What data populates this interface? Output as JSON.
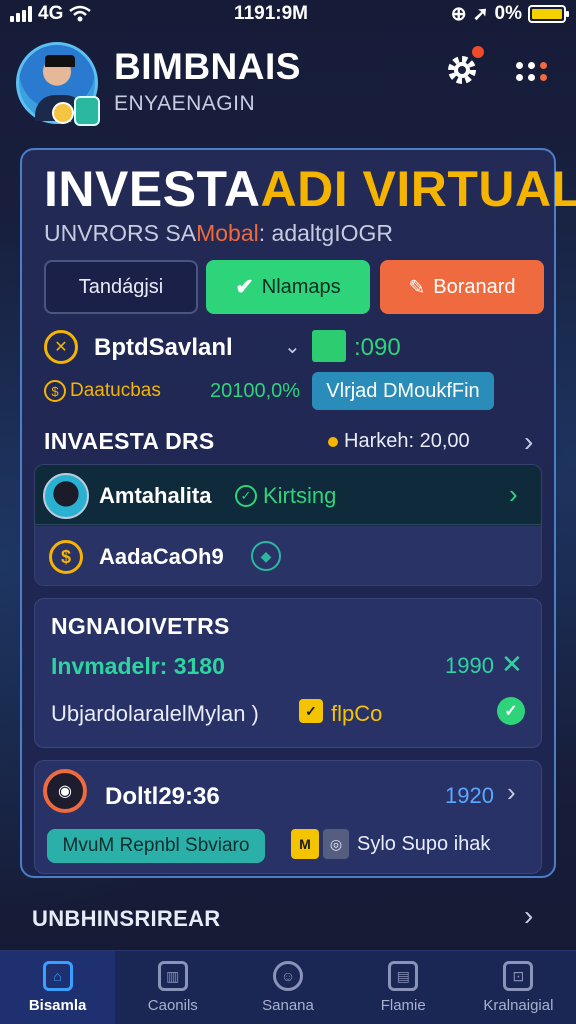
{
  "status_bar": {
    "carrier": "4G",
    "time": "1191:9M",
    "battery": "0%"
  },
  "header": {
    "app_title": "BIMBNAIS",
    "app_subtitle": "ENYAENAGIN"
  },
  "hero": {
    "title_white": "INVESTA",
    "title_accent": "ADI VIRTUAL",
    "subtitle_pre": "UNVRORS SA",
    "subtitle_highlight": "Mobal",
    "subtitle_post": ": adaltgIOGR",
    "btn_outline": "Tandágjsi",
    "btn_green": "Nlamaps",
    "btn_orange": "Boranard"
  },
  "stats": {
    "label": "BptdSavlanl",
    "value": ":090",
    "row2_label": "Daatucbas",
    "row2_value": "20100,0%",
    "pill": "Vlrjad DMoukfFin"
  },
  "investors": {
    "title": "INVAESTA DRS",
    "meta": "Harkeh: 20,00",
    "items": [
      {
        "name": "Amtahalita",
        "status": "Kirtsing"
      },
      {
        "name": "AadaCaOh9"
      }
    ]
  },
  "card2": {
    "title": "NGNAIOIVETRS",
    "line1": "Invmadelr: 3180",
    "line1_value": "1990",
    "line2": "UbjardolaralelMylan )",
    "tag": "flpCo"
  },
  "card3": {
    "title": "Doltl29:36",
    "value": "1920",
    "pill": "MvuM Repnbl Sbviaro",
    "mini_y": "M",
    "text": "Sylo Supo ihak"
  },
  "bottom": {
    "title": "UNBHINSRIREAR"
  },
  "tabbar": {
    "tabs": [
      {
        "label": "Bisamla",
        "icon": "home-icon",
        "active": true
      },
      {
        "label": "Caonils",
        "icon": "chart-icon"
      },
      {
        "label": "Sanana",
        "icon": "profile-icon"
      },
      {
        "label": "Flamie",
        "icon": "document-icon"
      },
      {
        "label": "Kralnaigial",
        "icon": "lock-icon"
      }
    ]
  },
  "colors": {
    "accent_yellow": "#f5b400",
    "accent_green": "#2ed47a",
    "accent_orange": "#ef6a3e",
    "accent_teal": "#2ab0a8",
    "background": "#141a33"
  }
}
